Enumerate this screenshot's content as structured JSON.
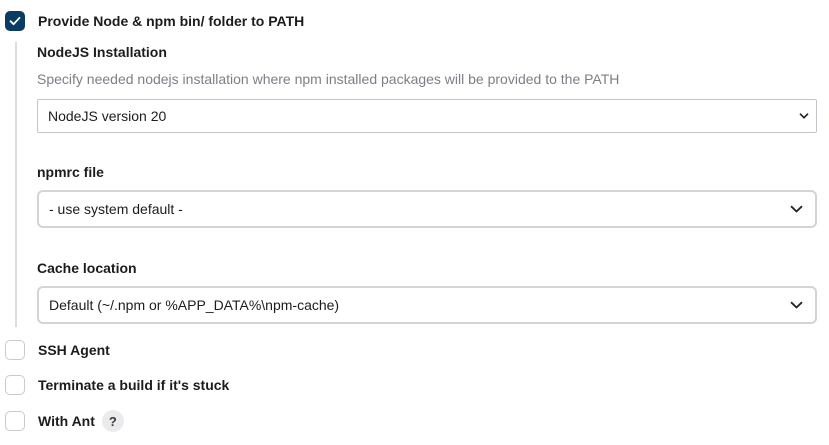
{
  "node_section": {
    "checkbox_label": "Provide Node & npm bin/ folder to PATH",
    "checked": true,
    "installation": {
      "label": "NodeJS Installation",
      "description": "Specify needed nodejs installation where npm installed packages will be provided to the PATH",
      "selected": "NodeJS version 20"
    },
    "npmrc": {
      "label": "npmrc file",
      "selected": "- use system default -"
    },
    "cache": {
      "label": "Cache location",
      "selected": "Default (~/.npm or %APP_DATA%\\npm-cache)"
    }
  },
  "options": [
    {
      "label": "SSH Agent",
      "checked": false
    },
    {
      "label": "Terminate a build if it's stuck",
      "checked": false
    },
    {
      "label": "With Ant",
      "checked": false,
      "help": "?"
    }
  ],
  "colors": {
    "accent": "#0c3c63",
    "muted_text": "#7c7f86",
    "border": "#d3d4d8"
  }
}
